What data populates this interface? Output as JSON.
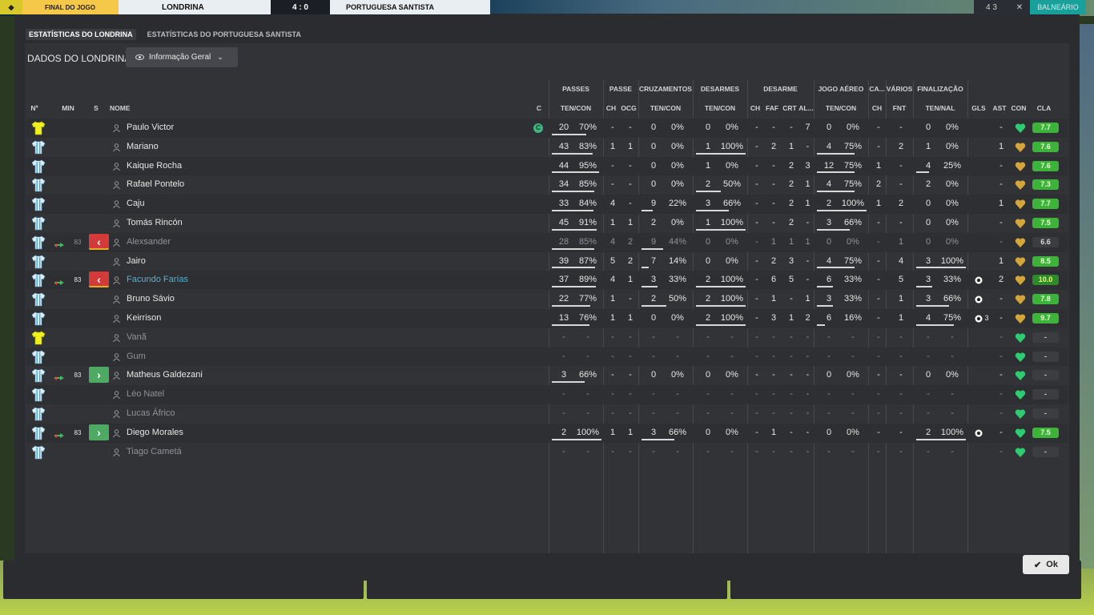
{
  "scoreboard": {
    "period": "FINAL DO JOGO",
    "home": "LONDRINA",
    "score": "4 : 0",
    "away": "PORTUGUESA SANTISTA"
  },
  "topright": {
    "count": "4 3",
    "close": "✕",
    "exit": "BALNEÁRIO"
  },
  "tabs": [
    "ESTATÍSTICAS DO LONDRINA",
    "ESTATÍSTICAS DO PORTUGUESA SANTISTA"
  ],
  "header": {
    "label": "DADOS DO LONDRINA",
    "dropdown": "Informação Geral"
  },
  "groups": {
    "passes": "PASSES",
    "passe": "PASSE",
    "cruz": "CRUZAMENTOS",
    "desarmes": "DESARMES",
    "desarme": "DESARME",
    "aereo": "JOGO AÉREO",
    "ca": "CA...",
    "varios": "VÁRIOS",
    "final": "FINALIZAÇÃO"
  },
  "columns": {
    "num": "Nº",
    "min": "MIN",
    "s": "S",
    "nome": "NOME",
    "c": "C",
    "tencon": "TEN/CON",
    "ch": "CH",
    "ocg": "OCG",
    "faf": "FAF",
    "crt": "CRT",
    "al": "AL...",
    "fnt": "FNT",
    "tennal": "TEN/NAL",
    "gls": "GLS",
    "ast": "AST",
    "con": "CON",
    "cla": "CLA"
  },
  "colors": {
    "panel": "#2b2c2f",
    "rating_green": "#3db33a",
    "heart_green": "#2ecc71",
    "heart_gold": "#d4a53a",
    "sub_out": "#d53a3a",
    "sub_in": "#4caa62",
    "highlight": "#4fb2d8"
  },
  "players": [
    {
      "name": "Paulo Victor",
      "kit": "gk",
      "captain": "C",
      "pass_t": "20",
      "pass_p": "70%",
      "pass_f": 0.7,
      "ch1": "-",
      "ocg": "-",
      "cr_t": "0",
      "cr_p": "0%",
      "cr_f": 0,
      "ds_t": "0",
      "ds_p": "0%",
      "ds_f": 0,
      "d_ch": "-",
      "faf": "-",
      "crt": "-",
      "al": "7",
      "ae_t": "0",
      "ae_p": "0%",
      "ae_f": 0,
      "ca": "-",
      "fnt": "-",
      "fi_t": "0",
      "fi_p": "0%",
      "fi_f": 0,
      "gls": "",
      "ast": "-",
      "heart": "green",
      "rating": "7.7",
      "rtype": "g"
    },
    {
      "name": "Mariano",
      "kit": "out",
      "pass_t": "43",
      "pass_p": "83%",
      "pass_f": 0.83,
      "ch1": "1",
      "ocg": "1",
      "cr_t": "0",
      "cr_p": "0%",
      "cr_f": 0,
      "ds_t": "1",
      "ds_p": "100%",
      "ds_f": 1,
      "d_ch": "-",
      "faf": "2",
      "crt": "1",
      "al": "-",
      "ae_t": "4",
      "ae_p": "75%",
      "ae_f": 0.75,
      "ca": "-",
      "fnt": "2",
      "fi_t": "1",
      "fi_p": "0%",
      "fi_f": 0,
      "gls": "",
      "ast": "1",
      "heart": "gold",
      "rating": "7.6",
      "rtype": "g"
    },
    {
      "name": "Kaique Rocha",
      "kit": "out",
      "pass_t": "44",
      "pass_p": "95%",
      "pass_f": 0.95,
      "ch1": "-",
      "ocg": "-",
      "cr_t": "0",
      "cr_p": "0%",
      "cr_f": 0,
      "ds_t": "1",
      "ds_p": "0%",
      "ds_f": 0,
      "d_ch": "-",
      "faf": "-",
      "crt": "2",
      "al": "3",
      "ae_t": "12",
      "ae_p": "75%",
      "ae_f": 0.75,
      "ca": "1",
      "fnt": "-",
      "fi_t": "4",
      "fi_p": "25%",
      "fi_f": 0.25,
      "gls": "",
      "ast": "-",
      "heart": "gold",
      "rating": "7.6",
      "rtype": "g"
    },
    {
      "name": "Rafael Pontelo",
      "kit": "out",
      "pass_t": "34",
      "pass_p": "85%",
      "pass_f": 0.85,
      "ch1": "-",
      "ocg": "-",
      "cr_t": "0",
      "cr_p": "0%",
      "cr_f": 0,
      "ds_t": "2",
      "ds_p": "50%",
      "ds_f": 0.5,
      "d_ch": "-",
      "faf": "-",
      "crt": "2",
      "al": "1",
      "ae_t": "4",
      "ae_p": "75%",
      "ae_f": 0.75,
      "ca": "2",
      "fnt": "-",
      "fi_t": "2",
      "fi_p": "0%",
      "fi_f": 0,
      "gls": "",
      "ast": "-",
      "heart": "gold",
      "rating": "7.3",
      "rtype": "g"
    },
    {
      "name": "Caju",
      "kit": "out",
      "pass_t": "33",
      "pass_p": "84%",
      "pass_f": 0.84,
      "ch1": "4",
      "ocg": "-",
      "cr_t": "9",
      "cr_p": "22%",
      "cr_f": 0.22,
      "ds_t": "3",
      "ds_p": "66%",
      "ds_f": 0.66,
      "d_ch": "-",
      "faf": "-",
      "crt": "2",
      "al": "1",
      "ae_t": "2",
      "ae_p": "100%",
      "ae_f": 1,
      "ca": "1",
      "fnt": "2",
      "fi_t": "0",
      "fi_p": "0%",
      "fi_f": 0,
      "gls": "",
      "ast": "1",
      "heart": "gold",
      "rating": "7.7",
      "rtype": "g"
    },
    {
      "name": "Tomás Rincón",
      "kit": "out",
      "pass_t": "45",
      "pass_p": "91%",
      "pass_f": 0.91,
      "ch1": "1",
      "ocg": "1",
      "cr_t": "2",
      "cr_p": "0%",
      "cr_f": 0,
      "ds_t": "1",
      "ds_p": "100%",
      "ds_f": 1,
      "d_ch": "-",
      "faf": "-",
      "crt": "2",
      "al": "-",
      "ae_t": "3",
      "ae_p": "66%",
      "ae_f": 0.66,
      "ca": "-",
      "fnt": "-",
      "fi_t": "0",
      "fi_p": "0%",
      "fi_f": 0,
      "gls": "",
      "ast": "-",
      "heart": "gold",
      "rating": "7.5",
      "rtype": "g"
    },
    {
      "name": "Alexsander",
      "kit": "out",
      "dim": true,
      "sub": "83",
      "subtype": "out",
      "pass_t": "28",
      "pass_p": "85%",
      "pass_f": 0.85,
      "ch1": "4",
      "ocg": "2",
      "cr_t": "9",
      "cr_p": "44%",
      "cr_f": 0.44,
      "ds_t": "0",
      "ds_p": "0%",
      "ds_f": 0,
      "d_ch": "-",
      "faf": "1",
      "crt": "1",
      "al": "1",
      "ae_t": "0",
      "ae_p": "0%",
      "ae_f": 0,
      "ca": "-",
      "fnt": "1",
      "fi_t": "0",
      "fi_p": "0%",
      "fi_f": 0,
      "gls": "",
      "ast": "-",
      "heart": "gold",
      "rating": "6.6",
      "rtype": "n"
    },
    {
      "name": "Jairo",
      "kit": "out",
      "pass_t": "39",
      "pass_p": "87%",
      "pass_f": 0.87,
      "ch1": "5",
      "ocg": "2",
      "cr_t": "7",
      "cr_p": "14%",
      "cr_f": 0.14,
      "ds_t": "0",
      "ds_p": "0%",
      "ds_f": 0,
      "d_ch": "-",
      "faf": "2",
      "crt": "3",
      "al": "-",
      "ae_t": "4",
      "ae_p": "75%",
      "ae_f": 0.75,
      "ca": "-",
      "fnt": "4",
      "fi_t": "3",
      "fi_p": "100%",
      "fi_f": 1,
      "gls": "",
      "ast": "1",
      "heart": "gold",
      "rating": "8.5",
      "rtype": "g"
    },
    {
      "name": "Facundo Farías",
      "kit": "out",
      "hl": true,
      "sub": "83",
      "subtype": "out",
      "pass_t": "37",
      "pass_p": "89%",
      "pass_f": 0.89,
      "ch1": "4",
      "ocg": "1",
      "cr_t": "3",
      "cr_p": "33%",
      "cr_f": 0.33,
      "ds_t": "2",
      "ds_p": "100%",
      "ds_f": 1,
      "d_ch": "-",
      "faf": "6",
      "crt": "5",
      "al": "-",
      "ae_t": "6",
      "ae_p": "33%",
      "ae_f": 0.33,
      "ca": "-",
      "fnt": "5",
      "fi_t": "3",
      "fi_p": "33%",
      "fi_f": 0.33,
      "gls": "ball",
      "ast": "2",
      "heart": "gold",
      "rating": "10.0",
      "rtype": "lg"
    },
    {
      "name": "Bruno Sávio",
      "kit": "out",
      "pass_t": "22",
      "pass_p": "77%",
      "pass_f": 0.77,
      "ch1": "1",
      "ocg": "-",
      "cr_t": "2",
      "cr_p": "50%",
      "cr_f": 0.5,
      "ds_t": "2",
      "ds_p": "100%",
      "ds_f": 1,
      "d_ch": "-",
      "faf": "1",
      "crt": "-",
      "al": "1",
      "ae_t": "3",
      "ae_p": "33%",
      "ae_f": 0.33,
      "ca": "-",
      "fnt": "1",
      "fi_t": "3",
      "fi_p": "66%",
      "fi_f": 0.66,
      "gls": "ball",
      "ast": "-",
      "heart": "gold",
      "rating": "7.8",
      "rtype": "g"
    },
    {
      "name": "Keirrison",
      "kit": "out",
      "pass_t": "13",
      "pass_p": "76%",
      "pass_f": 0.76,
      "ch1": "1",
      "ocg": "1",
      "cr_t": "0",
      "cr_p": "0%",
      "cr_f": 0,
      "ds_t": "2",
      "ds_p": "100%",
      "ds_f": 1,
      "d_ch": "-",
      "faf": "3",
      "crt": "1",
      "al": "2",
      "ae_t": "6",
      "ae_p": "16%",
      "ae_f": 0.16,
      "ca": "-",
      "fnt": "1",
      "fi_t": "4",
      "fi_p": "75%",
      "fi_f": 0.75,
      "gls": "ball3",
      "ast": "-",
      "heart": "gold",
      "rating": "9.7",
      "rtype": "g"
    },
    {
      "name": "Vanã",
      "kit": "gk",
      "dim": true,
      "pass_t": "-",
      "pass_p": "-",
      "ch1": "-",
      "ocg": "-",
      "cr_t": "-",
      "cr_p": "-",
      "ds_t": "-",
      "ds_p": "-",
      "d_ch": "-",
      "faf": "-",
      "crt": "-",
      "al": "-",
      "ae_t": "-",
      "ae_p": "-",
      "ca": "-",
      "fnt": "-",
      "fi_t": "-",
      "fi_p": "-",
      "gls": "",
      "ast": "-",
      "heart": "green",
      "rating": "-",
      "rtype": "n"
    },
    {
      "name": "Gum",
      "kit": "out",
      "dim": true,
      "pass_t": "-",
      "pass_p": "-",
      "ch1": "-",
      "ocg": "-",
      "cr_t": "-",
      "cr_p": "-",
      "ds_t": "-",
      "ds_p": "-",
      "d_ch": "-",
      "faf": "-",
      "crt": "-",
      "al": "-",
      "ae_t": "-",
      "ae_p": "-",
      "ca": "-",
      "fnt": "-",
      "fi_t": "-",
      "fi_p": "-",
      "gls": "",
      "ast": "-",
      "heart": "green",
      "rating": "-",
      "rtype": "n"
    },
    {
      "name": "Matheus Galdezani",
      "kit": "out",
      "sub": "83",
      "subtype": "in",
      "pass_t": "3",
      "pass_p": "66%",
      "pass_f": 0.66,
      "ch1": "-",
      "ocg": "-",
      "cr_t": "0",
      "cr_p": "0%",
      "cr_f": 0,
      "ds_t": "0",
      "ds_p": "0%",
      "ds_f": 0,
      "d_ch": "-",
      "faf": "-",
      "crt": "-",
      "al": "-",
      "ae_t": "0",
      "ae_p": "0%",
      "ae_f": 0,
      "ca": "-",
      "fnt": "-",
      "fi_t": "0",
      "fi_p": "0%",
      "fi_f": 0,
      "gls": "",
      "ast": "-",
      "heart": "green",
      "rating": "-",
      "rtype": "n"
    },
    {
      "name": "Léo Natel",
      "kit": "out",
      "dim": true,
      "pass_t": "-",
      "pass_p": "-",
      "ch1": "-",
      "ocg": "-",
      "cr_t": "-",
      "cr_p": "-",
      "ds_t": "-",
      "ds_p": "-",
      "d_ch": "-",
      "faf": "-",
      "crt": "-",
      "al": "-",
      "ae_t": "-",
      "ae_p": "-",
      "ca": "-",
      "fnt": "-",
      "fi_t": "-",
      "fi_p": "-",
      "gls": "",
      "ast": "-",
      "heart": "green",
      "rating": "-",
      "rtype": "n"
    },
    {
      "name": "Lucas Áfrico",
      "kit": "out",
      "dim": true,
      "pass_t": "-",
      "pass_p": "-",
      "ch1": "-",
      "ocg": "-",
      "cr_t": "-",
      "cr_p": "-",
      "ds_t": "-",
      "ds_p": "-",
      "d_ch": "-",
      "faf": "-",
      "crt": "-",
      "al": "-",
      "ae_t": "-",
      "ae_p": "-",
      "ca": "-",
      "fnt": "-",
      "fi_t": "-",
      "fi_p": "-",
      "gls": "",
      "ast": "-",
      "heart": "green",
      "rating": "-",
      "rtype": "n"
    },
    {
      "name": "Diego Morales",
      "kit": "out",
      "sub": "83",
      "subtype": "in",
      "pass_t": "2",
      "pass_p": "100%",
      "pass_f": 1,
      "ch1": "1",
      "ocg": "1",
      "cr_t": "3",
      "cr_p": "66%",
      "cr_f": 0.66,
      "ds_t": "0",
      "ds_p": "0%",
      "ds_f": 0,
      "d_ch": "-",
      "faf": "1",
      "crt": "-",
      "al": "-",
      "ae_t": "0",
      "ae_p": "0%",
      "ae_f": 0,
      "ca": "-",
      "fnt": "-",
      "fi_t": "2",
      "fi_p": "100%",
      "fi_f": 1,
      "gls": "ball",
      "ast": "-",
      "heart": "green",
      "rating": "7.5",
      "rtype": "g"
    },
    {
      "name": "Tiago Cametá",
      "kit": "out",
      "dim": true,
      "pass_t": "-",
      "pass_p": "-",
      "ch1": "-",
      "ocg": "-",
      "cr_t": "-",
      "cr_p": "-",
      "ds_t": "-",
      "ds_p": "-",
      "d_ch": "-",
      "faf": "-",
      "crt": "-",
      "al": "-",
      "ae_t": "-",
      "ae_p": "-",
      "ca": "-",
      "fnt": "-",
      "fi_t": "-",
      "fi_p": "-",
      "gls": "",
      "ast": "-",
      "heart": "green",
      "rating": "-",
      "rtype": "n"
    }
  ],
  "ok": "Ok"
}
